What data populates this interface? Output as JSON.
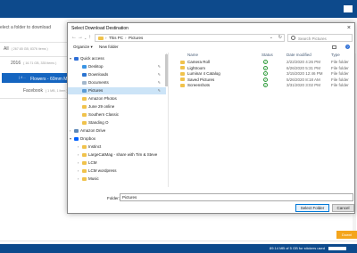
{
  "background": {
    "panel_title": "elect a folder to download",
    "rows": [
      {
        "label": "All",
        "sub": "( 267.65 GB, 8376 items )"
      },
      {
        "label": "2016",
        "sub": "( 16.71 GB, 335 items )"
      },
      {
        "label": "Flowers - 60mm Macro",
        "sub": "( 4 ..."
      },
      {
        "label": "Facebook",
        "sub": "( 1 MB, 1 item )"
      }
    ],
    "footer_status": "89.14 MB of 5 GB for stickers used",
    "download_button": "Downl"
  },
  "dialog": {
    "title": "Select Download Destination",
    "close": "×",
    "breadcrumb": [
      "This PC",
      "Pictures"
    ],
    "search_placeholder": "Search Pictures",
    "organize_label": "Organize ▾",
    "new_folder_label": "New folder",
    "nav_tree": [
      {
        "label": "Quick access",
        "icon": "star-icon",
        "level": 0,
        "chev": "▾"
      },
      {
        "label": "Desktop",
        "icon": "desktop-icon",
        "level": 1,
        "pinned": true
      },
      {
        "label": "Downloads",
        "icon": "download-icon",
        "level": 1,
        "pinned": true
      },
      {
        "label": "Documents",
        "icon": "document-icon",
        "level": 1,
        "pinned": true
      },
      {
        "label": "Pictures",
        "icon": "picture-icon",
        "level": 1,
        "pinned": true,
        "selected": true
      },
      {
        "label": "Amazon Photos",
        "icon": "folder-icon",
        "level": 1
      },
      {
        "label": "June 29 online",
        "icon": "folder-icon",
        "level": 1
      },
      {
        "label": "Southern Classic",
        "icon": "folder-icon",
        "level": 1
      },
      {
        "label": "Standing O",
        "icon": "folder-icon",
        "level": 1
      },
      {
        "label": "Amazon Drive",
        "icon": "amazon-drive-icon",
        "level": 0,
        "chev": "›"
      },
      {
        "label": "Dropbox",
        "icon": "dropbox-icon",
        "level": 0,
        "chev": "▾"
      },
      {
        "label": "Instinct",
        "icon": "folder-icon",
        "level": 1,
        "chev": "›"
      },
      {
        "label": "LargeCatMag - share with Tim & Steve",
        "icon": "folder-icon",
        "level": 1,
        "chev": "›"
      },
      {
        "label": "LCM",
        "icon": "folder-icon",
        "level": 1,
        "chev": "›"
      },
      {
        "label": "LCM wordpress",
        "icon": "folder-icon",
        "level": 1,
        "chev": "›"
      },
      {
        "label": "Music",
        "icon": "folder-icon",
        "level": 1,
        "chev": "›"
      }
    ],
    "columns": {
      "name": "Name",
      "status": "Status",
      "date": "Date modified",
      "type": "Type"
    },
    "files": [
      {
        "name": "Camera Roll",
        "date": "2/22/2020 4:26 PM",
        "type": "File folder"
      },
      {
        "name": "Lightroom",
        "date": "6/26/2020 5:31 PM",
        "type": "File folder"
      },
      {
        "name": "Luminar 4 Catalog",
        "date": "3/15/2020 12:46 PM",
        "type": "File folder"
      },
      {
        "name": "Saved Pictures",
        "date": "5/26/2020 8:18 AM",
        "type": "File folder"
      },
      {
        "name": "Screenshots",
        "date": "3/31/2020 3:02 PM",
        "type": "File folder"
      }
    ],
    "folder_label": "Folder:",
    "folder_value": "Pictures",
    "select_button": "Select Folder",
    "cancel_button": "Cancel"
  }
}
